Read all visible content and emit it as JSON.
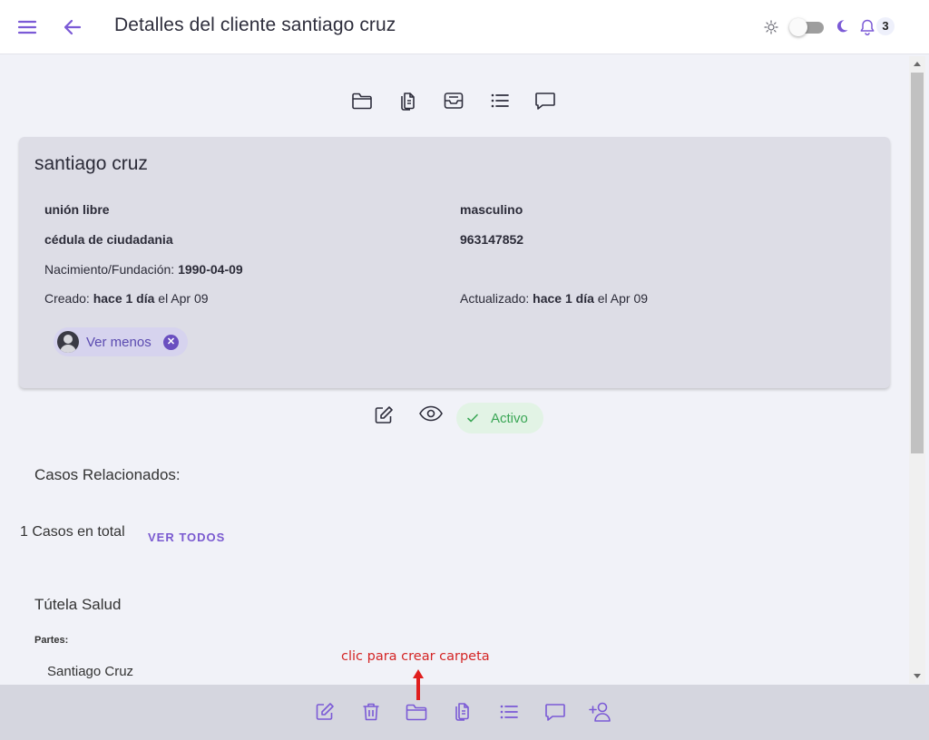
{
  "header": {
    "title": "Detalles del cliente santiago cruz",
    "notification_count": "3",
    "accent": "#7b5ad6"
  },
  "toolbar_top": {
    "icons": [
      "folder-icon",
      "documents-icon",
      "inbox-icon",
      "list-icon",
      "comment-icon"
    ]
  },
  "client": {
    "name": "santiago cruz",
    "civil_status": "unión libre",
    "gender": "masculino",
    "id_type": "cédula de ciudadania",
    "id_number": "963147852",
    "birth_label": "Nacimiento/Fundación:",
    "birth_date": "1990-04-09",
    "created_label": "Creado:",
    "created_rel": "hace 1 día",
    "created_date": "el Apr 09",
    "updated_label": "Actualizado:",
    "updated_rel": "hace 1 día",
    "updated_date": "el Apr 09",
    "chip_label": "Ver menos"
  },
  "status": {
    "label": "Activo",
    "color": "#3aa655"
  },
  "cases": {
    "section_title": "Casos Relacionados:",
    "total_text": "1 Casos en total",
    "view_all": "VER TODOS",
    "case_title": "Tútela Salud",
    "parties_label": "Partes:",
    "party_name": "Santiago Cruz"
  },
  "annotation": {
    "text": "clic para crear carpeta"
  },
  "toolbar_bottom": {
    "icons": [
      "edit-icon",
      "trash-icon",
      "folder-icon",
      "documents-icon",
      "list-icon",
      "comment-icon",
      "add-user-icon"
    ]
  }
}
